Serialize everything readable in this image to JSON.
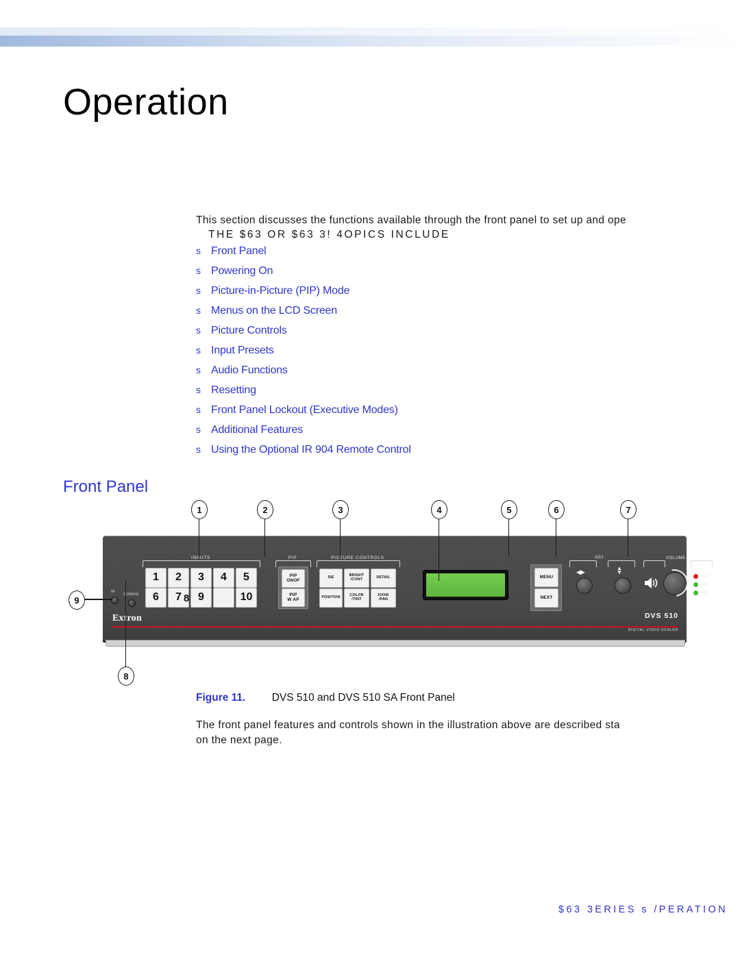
{
  "page": {
    "title": "Operation"
  },
  "intro": {
    "line1": "This section discusses the functions available through the front panel to set up and ope",
    "line2": "THE $63      OR $63      3!  4OPICS  INCLUDE"
  },
  "toc": {
    "bullet": "s",
    "items": [
      {
        "label": "Front Panel"
      },
      {
        "label": "Powering On"
      },
      {
        "label": "Picture-in-Picture (PIP) Mode"
      },
      {
        "label": "Menus on the LCD Screen"
      },
      {
        "label": "Picture Controls"
      },
      {
        "label": "Input Presets"
      },
      {
        "label": "Audio Functions"
      },
      {
        "label": "Resetting"
      },
      {
        "label": "Front Panel Lockout (Executive Modes)"
      },
      {
        "label": "Additional Features"
      },
      {
        "label": "Using the Optional IR 904 Remote Control"
      }
    ]
  },
  "section": {
    "heading": "Front Panel"
  },
  "figure": {
    "callouts": [
      {
        "n": "1"
      },
      {
        "n": "2"
      },
      {
        "n": "3"
      },
      {
        "n": "4"
      },
      {
        "n": "5"
      },
      {
        "n": "6"
      },
      {
        "n": "7"
      },
      {
        "n": "8"
      },
      {
        "n": "9"
      }
    ],
    "groups": {
      "inputs": "INPUTS",
      "pip": "PIP",
      "picture_controls": "PICTURE CONTROLS",
      "adjust": "ADJ",
      "volume": "VOLUME"
    },
    "input_buttons_row1": [
      "1",
      "2",
      "3",
      "4",
      "5"
    ],
    "input_buttons_row2": [
      "6",
      "7",
      "9",
      "",
      "10"
    ],
    "input_button_overlap": "8",
    "pip_buttons": [
      {
        "l1": "PIP",
        "l2": "ONOF"
      },
      {
        "l1": "PIP",
        "l2": "W AP"
      }
    ],
    "picture_buttons": [
      {
        "l1": "SIE",
        "l2": ""
      },
      {
        "l1": "BRIGHT",
        "l2": "/CONT"
      },
      {
        "l1": "DETAIL",
        "l2": ""
      },
      {
        "l1": "POSITION",
        "l2": ""
      },
      {
        "l1": "COLOR",
        "l2": "/TINT"
      },
      {
        "l1": "IOOM",
        "l2": "/PAN"
      }
    ],
    "menu_buttons": [
      {
        "label": "MENU"
      },
      {
        "label": "NEXT"
      }
    ],
    "leds": [
      {
        "label": "MAX",
        "color": "#e01b1b"
      },
      {
        "label": "MID",
        "color": "#3fbf2f"
      },
      {
        "label": "MIN",
        "color": "#3fbf2f"
      }
    ],
    "ports": {
      "ir": "IR",
      "config": "CONFIG"
    },
    "brand": "Extron",
    "model": "DVS 510",
    "model_sub": "DIGITAL VIDEO SCALER",
    "lcd_color": "#6cc24a",
    "accent_red": "#d0101c"
  },
  "caption": {
    "number": "Figure 11.",
    "text": "DVS 510 and DVS 510 SA Front Panel"
  },
  "outro": {
    "line1": "The front panel features and controls shown in the illustration above are described sta",
    "line2": "on the next page."
  },
  "footer": {
    "text": "$63      3ERIES  s  /PERATION"
  }
}
